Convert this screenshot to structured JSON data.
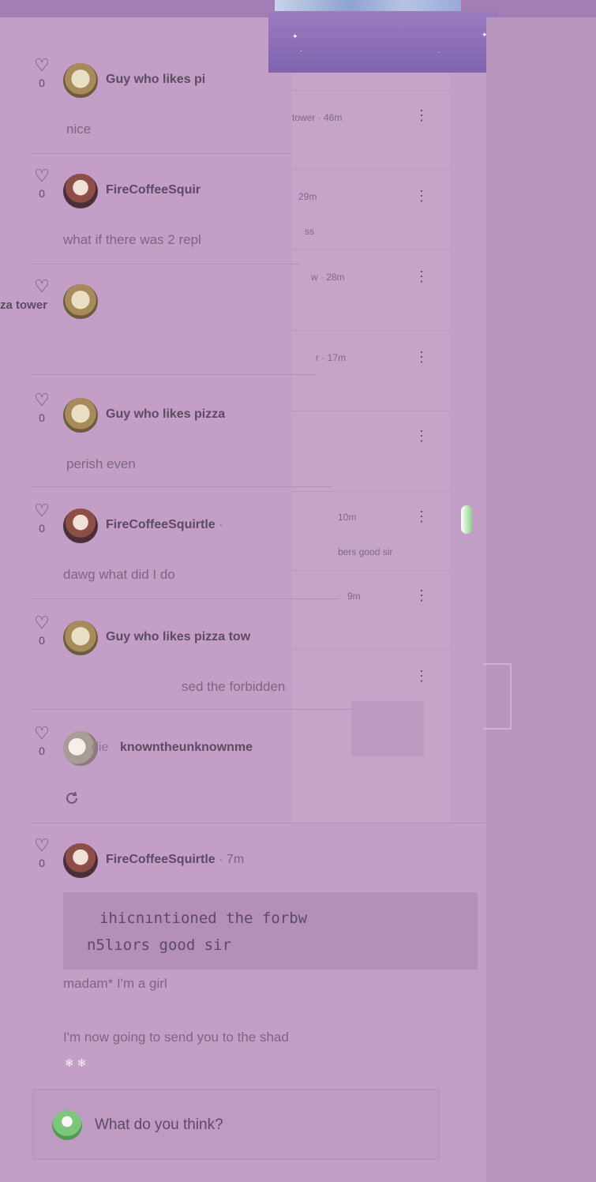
{
  "comments": [
    {
      "username": "Guy who likes pi",
      "time": "",
      "likes": "0",
      "body": "nice",
      "avatar": "guy-avatar"
    },
    {
      "username": "FireCoffeeSquir",
      "time": "",
      "likes": "0",
      "body": "what if there was 2 repl",
      "avatar": "fire-avatar"
    },
    {
      "username": "",
      "time": "",
      "likes": "",
      "body": "",
      "avatar": "guy-avatar"
    },
    {
      "username": "Guy who likes pizza",
      "time": "",
      "likes": "0",
      "body": "perish even",
      "avatar": "guy-avatar"
    },
    {
      "username": "FireCoffeeSquirtle",
      "time": "·",
      "likes": "0",
      "body": "dawg what did I do",
      "avatar": "fire-avatar"
    },
    {
      "username": "Guy who likes pizza tow",
      "time": "",
      "likes": "0",
      "body": "sed the forbidden",
      "avatar": "guy-avatar"
    },
    {
      "username": "knowntheunknownme",
      "time": "",
      "likes": "0",
      "body": "",
      "avatar": "unknown-avatar"
    }
  ],
  "ghost_layer": {
    "items": [
      {
        "text": "tower · 46m"
      },
      {
        "text": "29m"
      },
      {
        "text": "ss"
      },
      {
        "text": "w · 28m"
      },
      {
        "text": "r · 17m"
      },
      {
        "text": "10m"
      },
      {
        "text": "bers good sir"
      },
      {
        "text": "9m"
      }
    ],
    "left_fragment": "za tower",
    "side_fragment": "die"
  },
  "last_comment": {
    "username": "FireCoffeeSquirtle",
    "time": "· 7m",
    "likes": "0",
    "quote_line1": "ihicnıntioned the forbw",
    "quote_line2": "n5lıors good sir",
    "reply_line1": "madam* I'm a girl",
    "reply_line2": "I'm now going to send you to the shad"
  },
  "composer": {
    "placeholder": "What do you think?"
  },
  "colors": {
    "background": "#c39ec6",
    "banner": "#8a6db6",
    "text": "#5d4a63"
  }
}
